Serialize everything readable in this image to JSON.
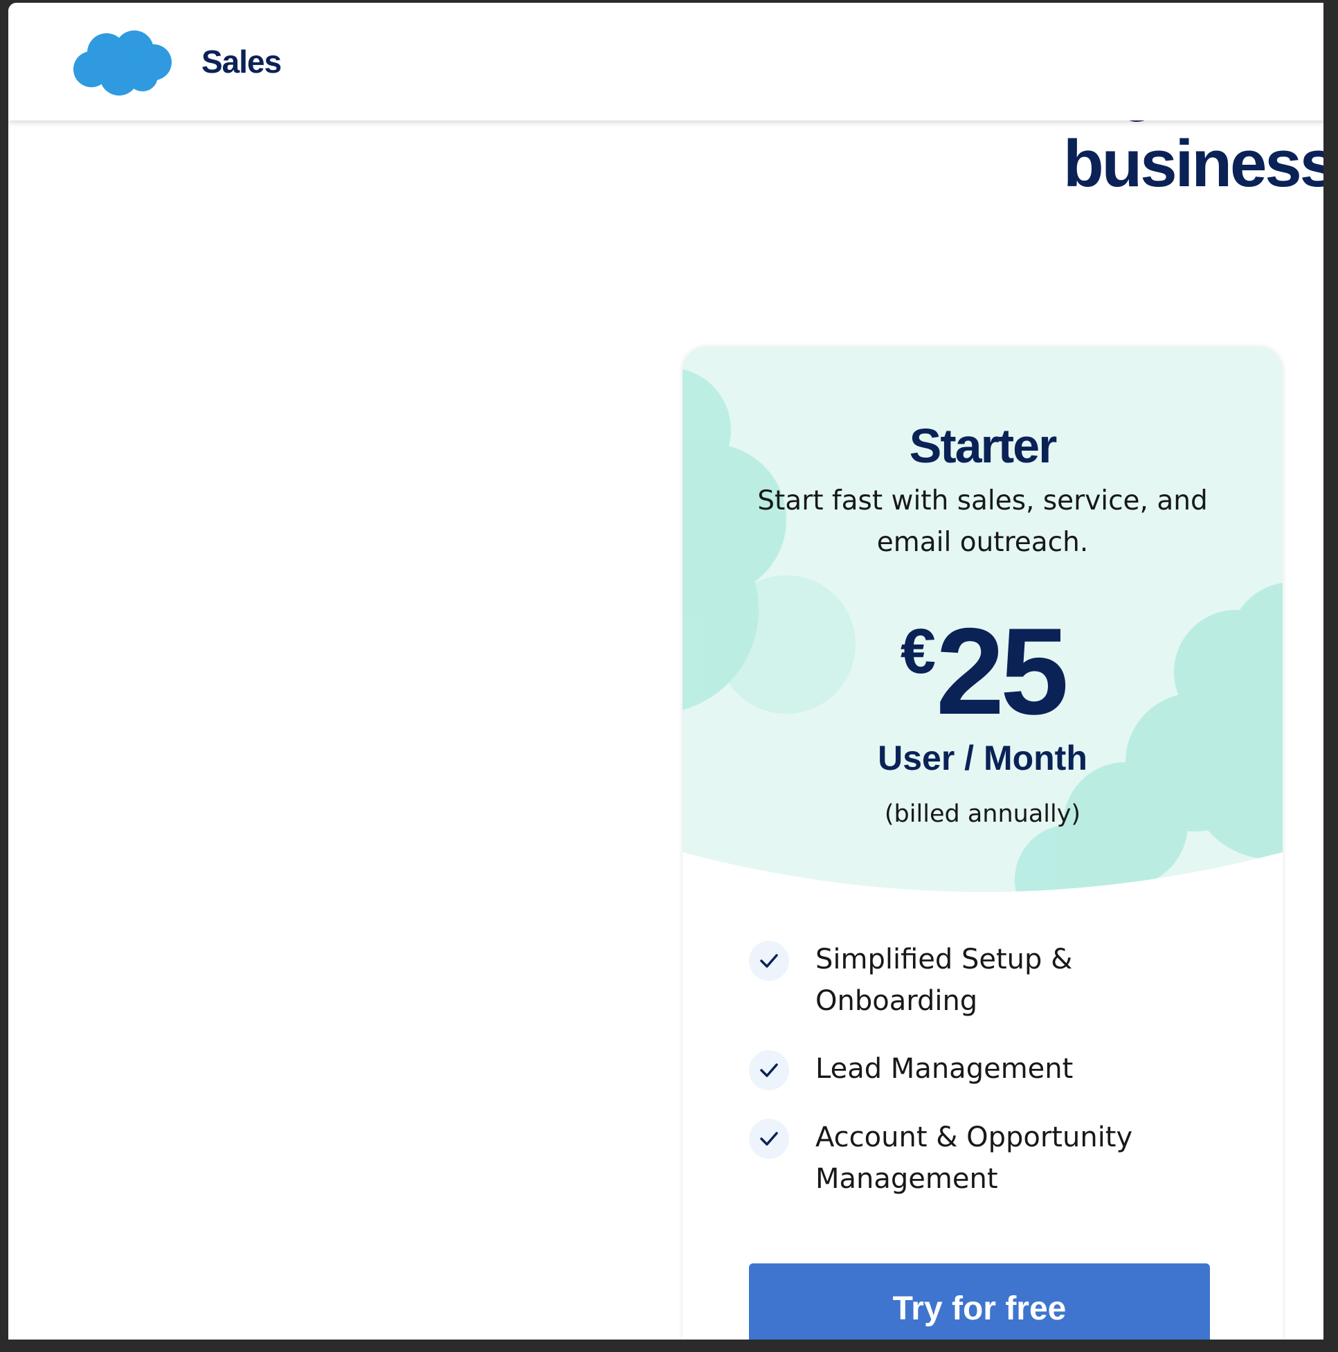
{
  "header": {
    "brand": "Sales"
  },
  "hero": {
    "visible_word": "business"
  },
  "plan": {
    "name": "Starter",
    "description": "Start fast with sales, service, and email outreach.",
    "currency_symbol": "€",
    "price": "25",
    "period": "User / Month",
    "billing_note": "(billed annually)",
    "features": [
      "Simplified Setup & Onboarding",
      "Lead Management",
      "Account & Opportunity Management"
    ],
    "cta_label": "Try for free"
  },
  "colors": {
    "brand_navy": "#0b2257",
    "logo_blue": "#2f9ae0",
    "mint": "#e4f7f3",
    "cloud_mint": "#b3ebe0",
    "cta_blue": "#3f75cf"
  },
  "icons": [
    "salesforce-cloud-logo",
    "check-icon"
  ]
}
